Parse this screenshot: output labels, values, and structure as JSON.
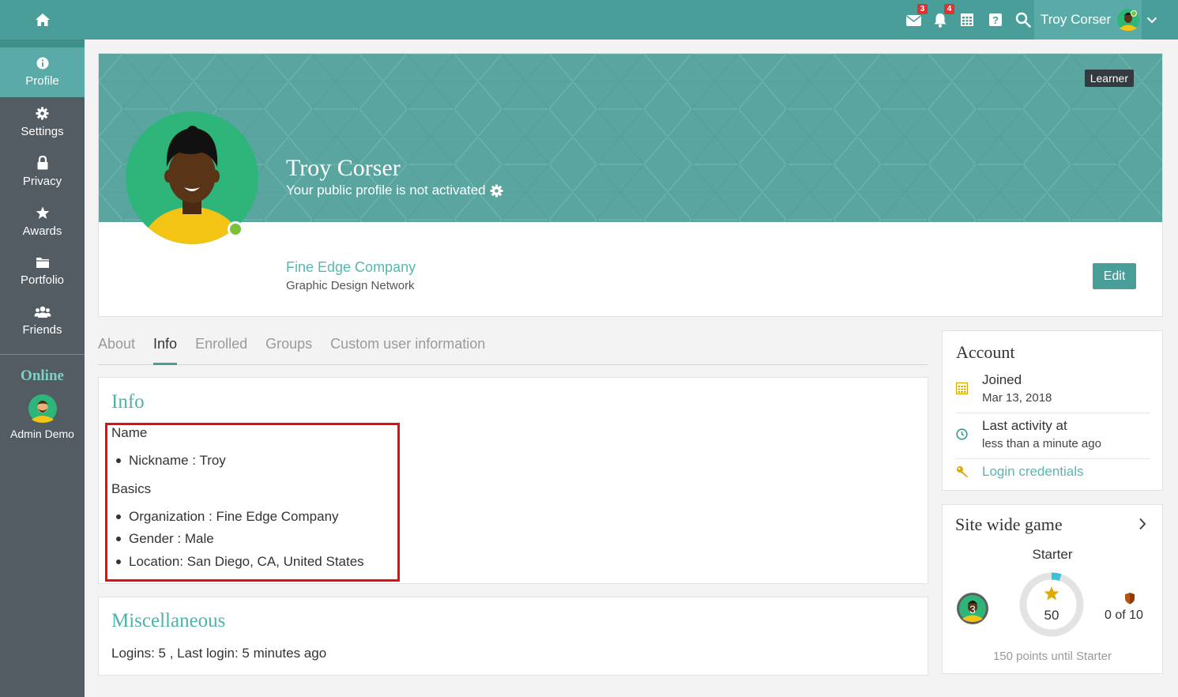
{
  "topbar": {
    "notifications": {
      "messages_count": "3",
      "alerts_count": "4"
    },
    "user_name": "Troy Corser"
  },
  "sidebar": {
    "items": [
      {
        "label": "Profile",
        "icon": "info-icon"
      },
      {
        "label": "Settings",
        "icon": "gear-icon"
      },
      {
        "label": "Privacy",
        "icon": "lock-icon"
      },
      {
        "label": "Awards",
        "icon": "star-icon"
      },
      {
        "label": "Portfolio",
        "icon": "folder-icon"
      },
      {
        "label": "Friends",
        "icon": "users-icon"
      }
    ],
    "online_title": "Online",
    "online_user": "Admin Demo"
  },
  "profile": {
    "role_tag": "Learner",
    "name": "Troy Corser",
    "public_status": "Your public profile is not activated",
    "company": "Fine Edge Company",
    "branch": "Graphic Design Network",
    "edit_label": "Edit"
  },
  "tabs": [
    {
      "label": "About"
    },
    {
      "label": "Info"
    },
    {
      "label": "Enrolled"
    },
    {
      "label": "Groups"
    },
    {
      "label": "Custom user information"
    }
  ],
  "info": {
    "title": "Info",
    "name_label": "Name",
    "nickname": "Nickname : Troy",
    "basics_label": "Basics",
    "organization": "Organization : Fine Edge Company",
    "gender": "Gender : Male",
    "location": "Location: San Diego, CA, United States"
  },
  "misc": {
    "title": "Miscellaneous",
    "text": "Logins: 5 , Last login: 5 minutes ago"
  },
  "account": {
    "title": "Account",
    "joined_label": "Joined",
    "joined_value": "Mar 13, 2018",
    "activity_label": "Last activity at",
    "activity_value": "less than a minute ago",
    "credentials_link": "Login credentials"
  },
  "game": {
    "title": "Site wide game",
    "level_name": "Starter",
    "level_number": "3",
    "points": "50",
    "badges": "0 of 10",
    "until_text": "150 points until Starter",
    "progress": 0.05
  },
  "colors": {
    "teal": "#4a9e9a",
    "banner": "#5aa59f",
    "link": "#55b8b0",
    "sidebar": "#535b63",
    "highlight": "#e00f12"
  }
}
